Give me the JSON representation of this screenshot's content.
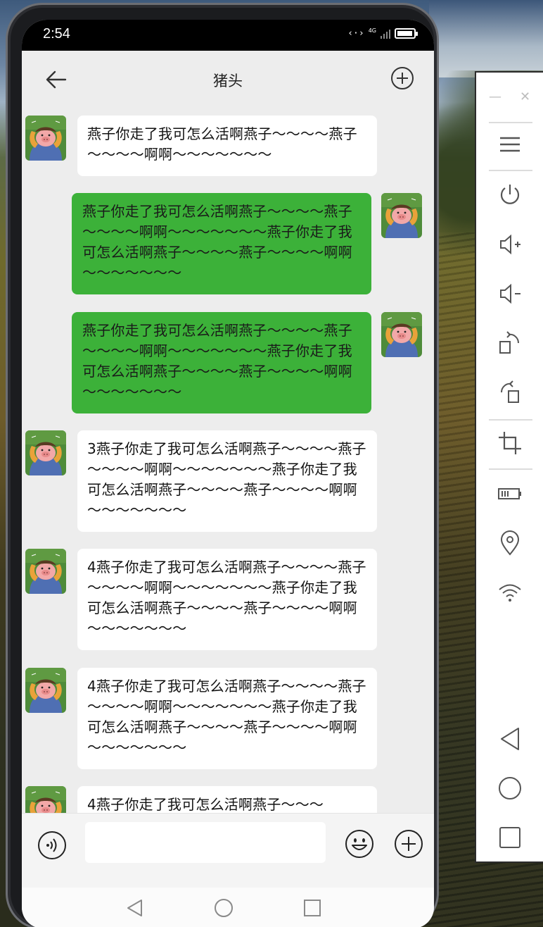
{
  "status": {
    "time": "2:54",
    "network": "4G"
  },
  "chat": {
    "title": "猪头",
    "input_value": "",
    "messages": [
      {
        "side": "left",
        "text": "燕子你走了我可怎么活啊燕子～～～～燕子～～～～啊啊～～～～～～～"
      },
      {
        "side": "right",
        "text": "燕子你走了我可怎么活啊燕子～～～～燕子～～～～啊啊～～～～～～～燕子你走了我可怎么活啊燕子～～～～燕子～～～～啊啊～～～～～～～"
      },
      {
        "side": "right",
        "text": "燕子你走了我可怎么活啊燕子～～～～燕子～～～～啊啊～～～～～～～燕子你走了我可怎么活啊燕子～～～～燕子～～～～啊啊～～～～～～～"
      },
      {
        "side": "left",
        "text": "3燕子你走了我可怎么活啊燕子～～～～燕子～～～～啊啊～～～～～～～燕子你走了我可怎么活啊燕子～～～～燕子～～～～啊啊～～～～～～～"
      },
      {
        "side": "left",
        "text": "4燕子你走了我可怎么活啊燕子～～～～燕子～～～～啊啊～～～～～～～燕子你走了我可怎么活啊燕子～～～～燕子～～～～啊啊～～～～～～～"
      },
      {
        "side": "left",
        "text": "4燕子你走了我可怎么活啊燕子～～～～燕子～～～～啊啊～～～～～～～燕子你走了我可怎么活啊燕子～～～～燕子～～～～啊啊～～～～～～～"
      },
      {
        "side": "left",
        "text": "4燕子你走了我可怎么活啊燕子～～～"
      }
    ]
  },
  "colors": {
    "sent_bubble": "#3cb139",
    "received_bubble": "#ffffff",
    "chat_background": "#ededed"
  },
  "icons": {
    "titlebar": [
      "back-arrow-icon",
      "add-circle-icon"
    ],
    "inputbar": [
      "voice-icon",
      "emoji-icon",
      "add-circle-icon"
    ],
    "navbar": [
      "nav-back-icon",
      "nav-home-icon",
      "nav-recents-icon"
    ],
    "emulator_toolbar": [
      "minimize-icon",
      "close-icon",
      "menu-icon",
      "power-icon",
      "volume-up-icon",
      "volume-down-icon",
      "rotate-right-icon",
      "rotate-left-icon",
      "crop-icon",
      "battery-icon",
      "location-icon",
      "wifi-icon",
      "back-icon",
      "home-icon",
      "overview-icon"
    ]
  }
}
